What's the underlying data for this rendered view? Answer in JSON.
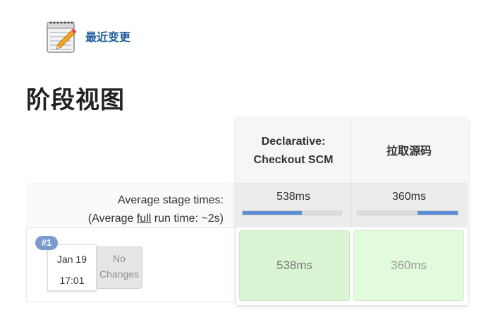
{
  "header": {
    "recent_changes_label": "最近变更",
    "recent_changes_icon": "notepad-pencil-icon"
  },
  "page_title": "阶段视图",
  "stage_view": {
    "avg_stage_times_label": "Average stage times:",
    "avg_run_time_prefix": "(Average ",
    "avg_run_time_link": "full",
    "avg_run_time_suffix": " run time: ~2s)",
    "stages": [
      {
        "name_line1": "Declarative:",
        "name_line2": "Checkout SCM",
        "avg_time": "538ms",
        "bar_fill_fraction": 0.6,
        "bar_align": "left"
      },
      {
        "name": "拉取源码",
        "avg_time": "360ms",
        "bar_fill_fraction": 0.4,
        "bar_align": "right"
      }
    ],
    "runs": [
      {
        "badge": "#1",
        "date": "Jan 19",
        "time": "17:01",
        "changes_line1": "No",
        "changes_line2": "Changes",
        "stage_times": [
          "538ms",
          "360ms"
        ]
      }
    ],
    "colors": {
      "stage_success": "#daf5d4",
      "progress_fill": "#5c8dd6",
      "badge": "#7a9ad0",
      "link": "#1f5e9c"
    }
  }
}
